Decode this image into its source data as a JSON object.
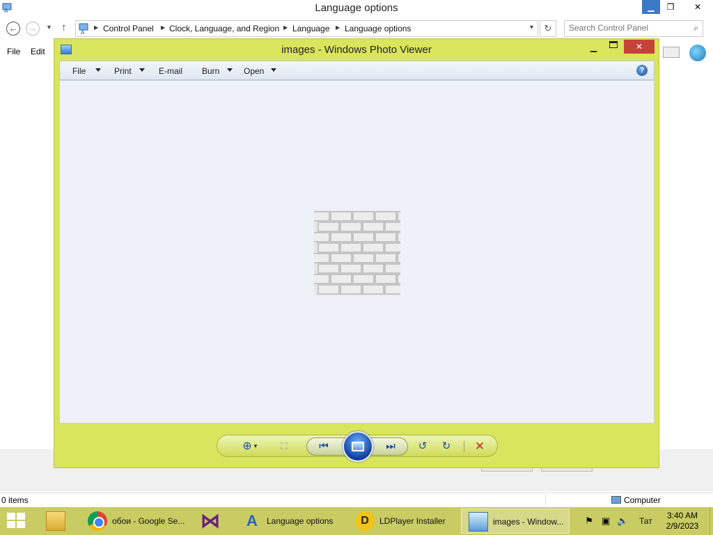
{
  "explorer": {
    "title": "Language options",
    "breadcrumb": [
      "Control Panel",
      "Clock, Language, and Region",
      "Language",
      "Language options"
    ],
    "search_placeholder": "Search Control Panel",
    "menu": [
      "File",
      "Edit"
    ],
    "status_items": "0 items",
    "status_location": "Computer"
  },
  "photo_viewer": {
    "title": "images - Windows Photo Viewer",
    "toolbar": [
      "File",
      "Print",
      "E-mail",
      "Burn",
      "Open"
    ],
    "help_label": "?",
    "controls": {
      "zoom_icon": "zoom-icon",
      "fit_icon": "actual-size-icon",
      "prev_icon": "previous-icon",
      "slideshow_icon": "slideshow-icon",
      "next_icon": "next-icon",
      "rotate_ccw_icon": "rotate-counterclockwise-icon",
      "rotate_cw_icon": "rotate-clockwise-icon",
      "delete_icon": "delete-icon"
    }
  },
  "taskbar": {
    "items": [
      {
        "label": "",
        "icon": "file-explorer-icon"
      },
      {
        "label": "обои - Google Se...",
        "icon": "chrome-icon"
      },
      {
        "label": "",
        "icon": "visual-studio-icon"
      },
      {
        "label": "Language options",
        "icon": "language-icon"
      },
      {
        "label": "LDPlayer Installer",
        "icon": "ldplayer-icon"
      },
      {
        "label": "images - Window...",
        "icon": "photo-viewer-icon"
      }
    ],
    "language": "Тат",
    "time": "3:40 AM",
    "date": "2/9/2023"
  },
  "colors": {
    "accent": "#d9e55c",
    "taskbar": "#c9cc62",
    "close": "#c7423a"
  }
}
